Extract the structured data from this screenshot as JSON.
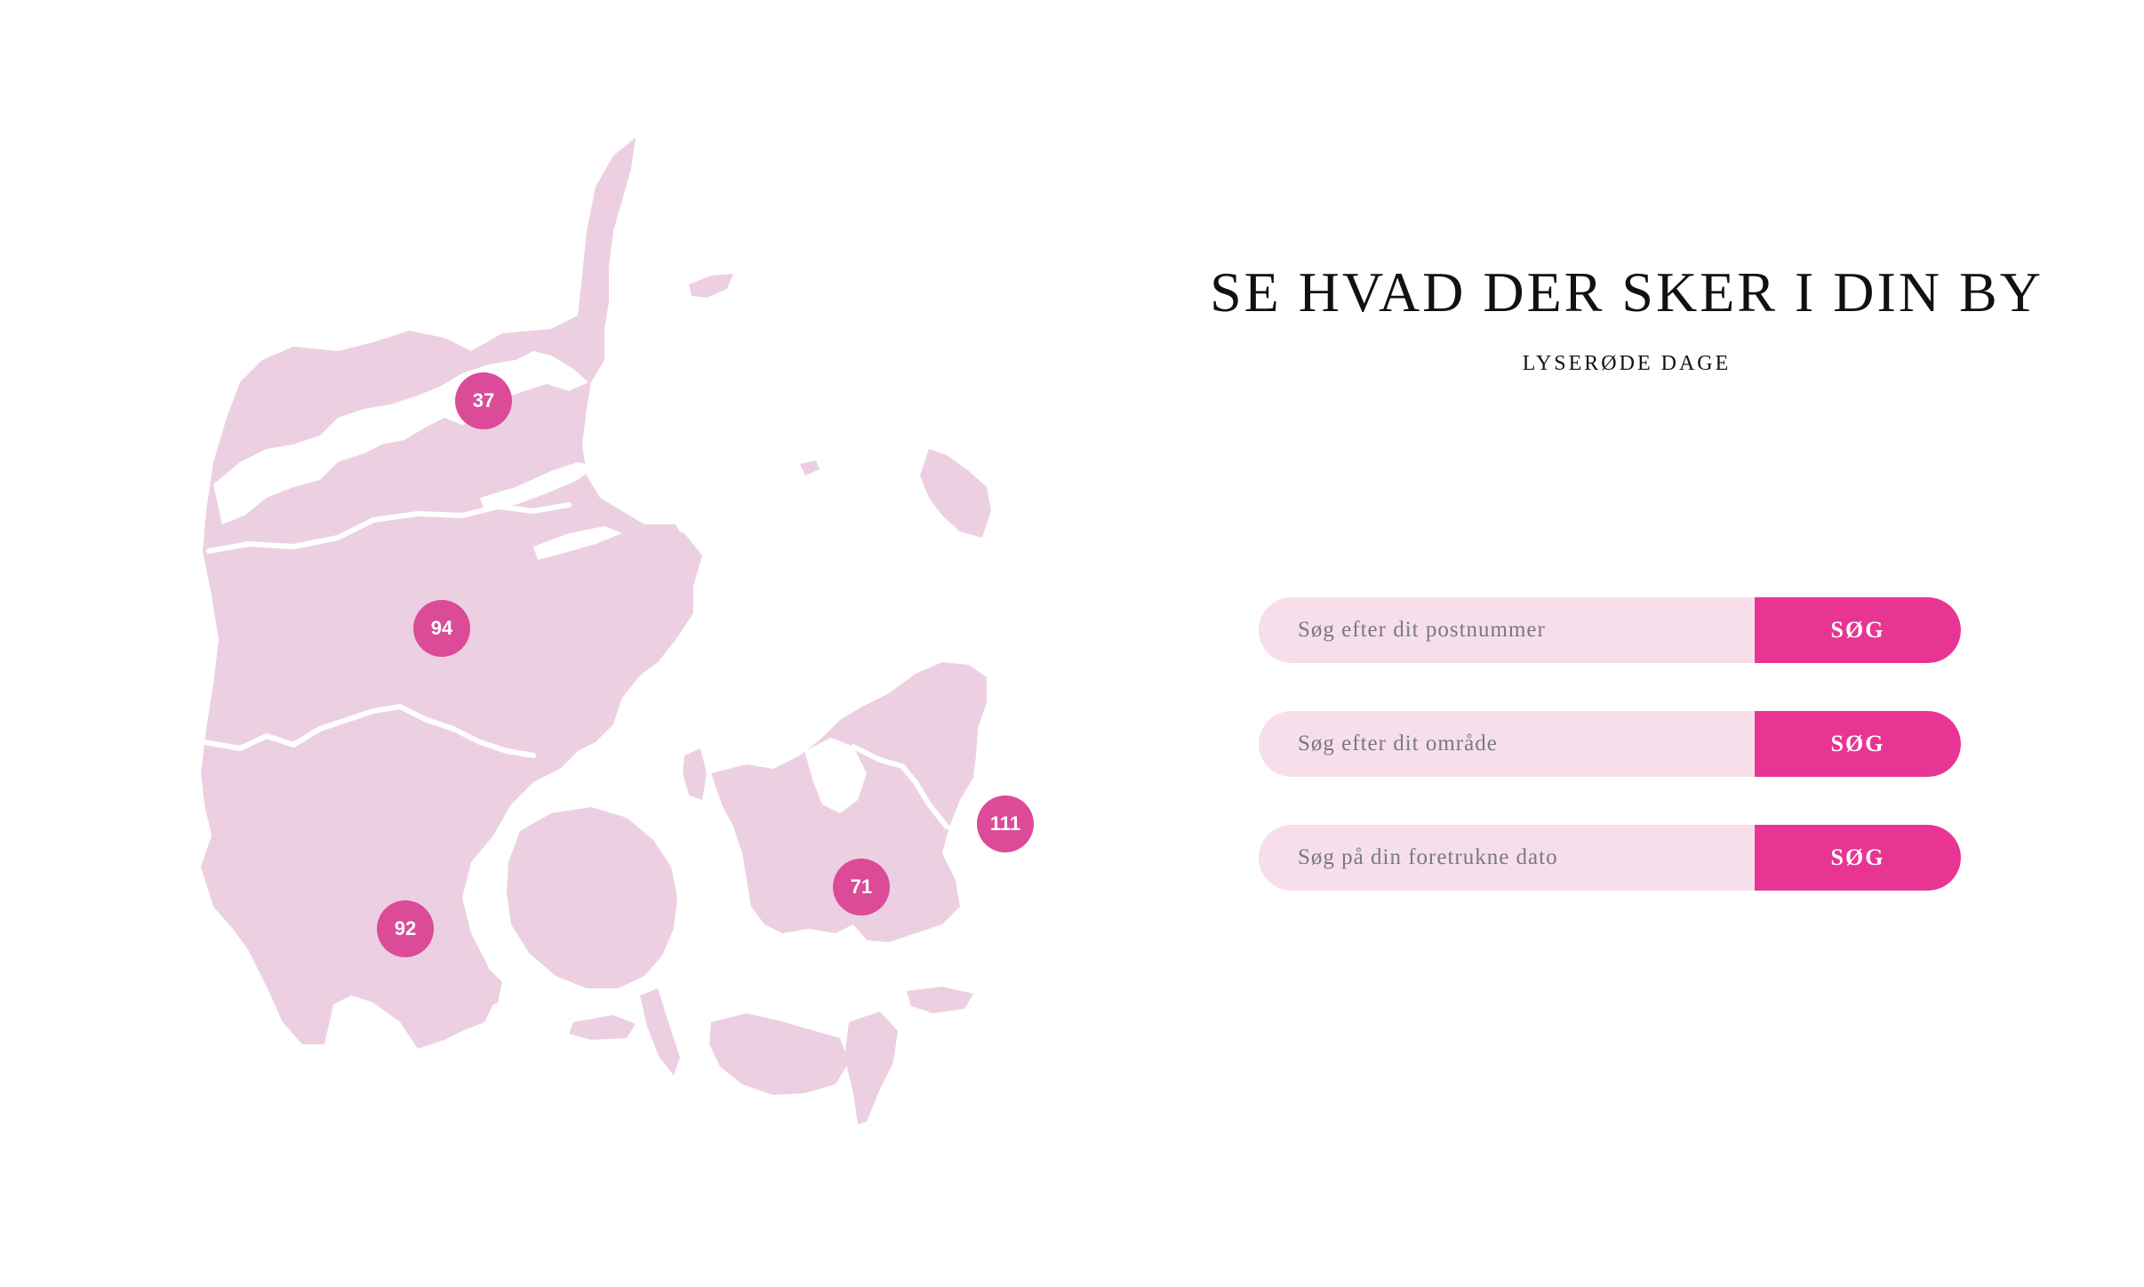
{
  "header": {
    "title": "SE HVAD DER SKER I DIN BY",
    "subtitle": "LYSERØDE DAGE"
  },
  "map": {
    "land_color": "#ecd0e1",
    "marker_color": "#db4b98",
    "regions": [
      {
        "name": "nordjylland",
        "count": "37"
      },
      {
        "name": "midtjylland",
        "count": "94"
      },
      {
        "name": "syddanmark",
        "count": "92"
      },
      {
        "name": "sjaelland",
        "count": "71"
      },
      {
        "name": "hovedstaden",
        "count": "111"
      }
    ]
  },
  "search": {
    "input_bg": "#f6dfeb",
    "button_color": "#e83593",
    "forms": [
      {
        "placeholder": "Søg efter dit postnummer",
        "button_label": "SØG"
      },
      {
        "placeholder": "Søg efter dit område",
        "button_label": "SØG"
      },
      {
        "placeholder": "Søg på din foretrukne dato",
        "button_label": "SØG"
      }
    ]
  }
}
